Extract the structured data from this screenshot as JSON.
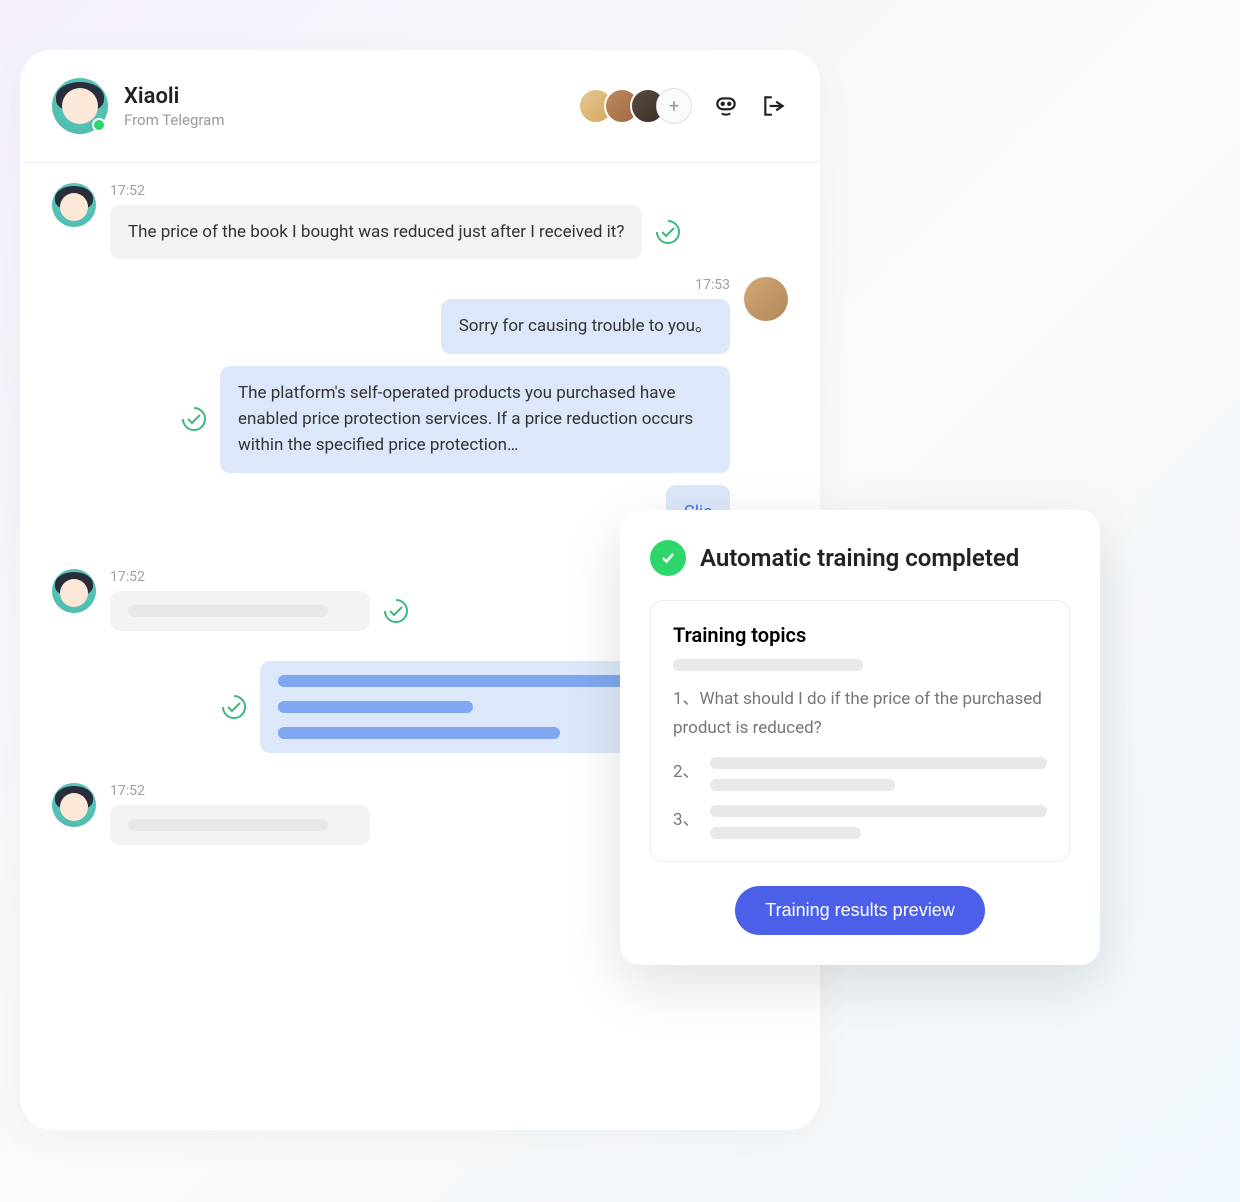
{
  "header": {
    "name": "Xiaoli",
    "source": "From Telegram"
  },
  "messages": {
    "m1_time": "17:52",
    "m1_text": "The price of the book I bought was reduced just after I received it?",
    "m2_time": "17:53",
    "m2_text": "Sorry for causing trouble to you。",
    "m3_text": "The platform's self-operated products you purchased have enabled price protection services. If a price reduction occurs within the specified price protection…",
    "m4_link": "Clic",
    "m5_time": "17:52",
    "m6_time": "17:52"
  },
  "training": {
    "title": "Automatic training completed",
    "topics_label": "Training topics",
    "topic1": "1、What should I do if the price of the purchased product is reduced?",
    "topic2_num": "2、",
    "topic3_num": "3、",
    "preview_btn": "Training results preview"
  }
}
